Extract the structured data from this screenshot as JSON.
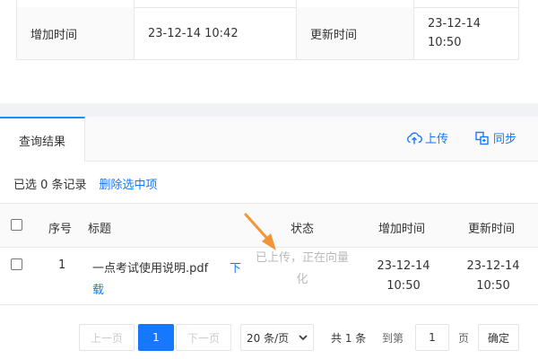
{
  "detail": {
    "label_created": "增加时间",
    "value_created": "23-12-14 10:42",
    "label_updated": "更新时间",
    "value_updated_line1": "23-12-14",
    "value_updated_line2": "10:50"
  },
  "tabs": {
    "active": "查询结果",
    "upload": "上传",
    "sync": "同步"
  },
  "selection": {
    "summary": "已选 0 条记录",
    "clear_link": "删除选中项"
  },
  "table": {
    "columns": {
      "index": "序号",
      "title": "标题",
      "status": "状态",
      "created": "增加时间",
      "updated": "更新时间"
    },
    "rows": [
      {
        "index": "1",
        "title": "一点考试使用说明.pdf",
        "download_line1": "下",
        "download_line2": "载",
        "status_line1": "已上传，正在向量",
        "status_line2": "化",
        "created_line1": "23-12-14",
        "created_line2": "10:50",
        "updated_line1": "23-12-14",
        "updated_line2": "10:50"
      }
    ]
  },
  "pagination": {
    "prev": "上一页",
    "current": "1",
    "next": "下一页",
    "page_size": "20 条/页",
    "total": "共 1 条",
    "goto": "到第",
    "goto_value": "1",
    "page_unit": "页",
    "confirm": "确定"
  },
  "colors": {
    "accent": "#1677ff",
    "arrow": "#f39436"
  }
}
